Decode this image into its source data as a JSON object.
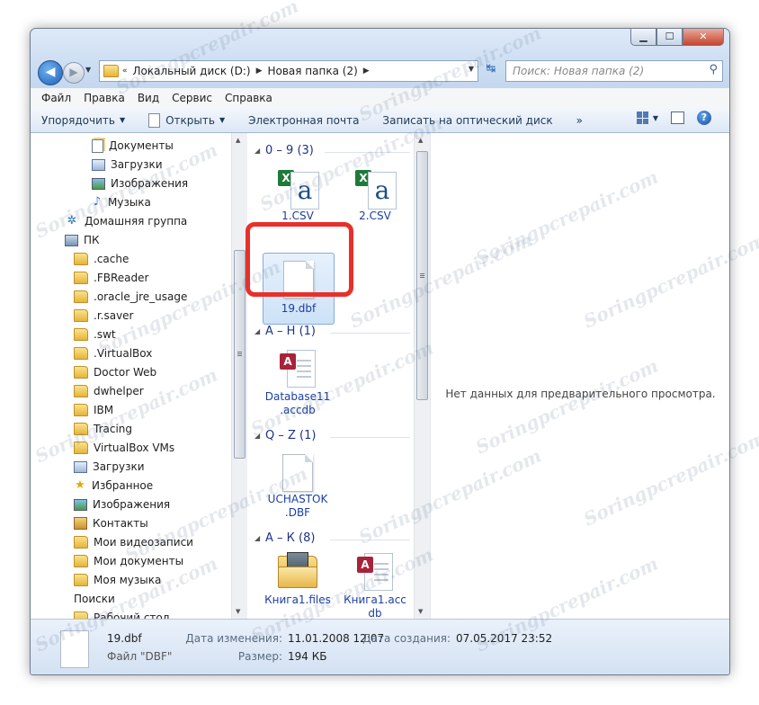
{
  "address": {
    "crumbs": [
      "Локальный диск (D:)",
      "Новая папка (2)"
    ],
    "overflow": "«"
  },
  "search": {
    "placeholder": "Поиск: Новая папка (2)"
  },
  "menu": [
    "Файл",
    "Правка",
    "Вид",
    "Сервис",
    "Справка"
  ],
  "toolbar": {
    "organize": "Упорядочить",
    "open": "Открыть",
    "email": "Электронная почта",
    "burn": "Записать на оптический диск",
    "more": "»"
  },
  "nav": [
    {
      "label": "Документы",
      "icon": "doc"
    },
    {
      "label": "Загрузки",
      "icon": "dl"
    },
    {
      "label": "Изображения",
      "icon": "img"
    },
    {
      "label": "Музыка",
      "icon": "music"
    },
    {
      "label": "Домашняя группа",
      "icon": "home"
    },
    {
      "label": "ПК",
      "icon": "pc"
    },
    {
      "label": ".cache",
      "icon": "folder"
    },
    {
      "label": ".FBReader",
      "icon": "folder"
    },
    {
      "label": ".oracle_jre_usage",
      "icon": "folder"
    },
    {
      "label": ".r.saver",
      "icon": "folder"
    },
    {
      "label": ".swt",
      "icon": "folder"
    },
    {
      "label": ".VirtualBox",
      "icon": "folder"
    },
    {
      "label": "Doctor Web",
      "icon": "folder"
    },
    {
      "label": "dwhelper",
      "icon": "folder"
    },
    {
      "label": "IBM",
      "icon": "folder"
    },
    {
      "label": "Tracing",
      "icon": "folder"
    },
    {
      "label": "VirtualBox VMs",
      "icon": "folder"
    },
    {
      "label": "Загрузки",
      "icon": "dl"
    },
    {
      "label": "Избранное",
      "icon": "star"
    },
    {
      "label": "Изображения",
      "icon": "img"
    },
    {
      "label": "Контакты",
      "icon": "contact"
    },
    {
      "label": "Мои видеозаписи",
      "icon": "folder"
    },
    {
      "label": "Мои документы",
      "icon": "folder"
    },
    {
      "label": "Моя музыка",
      "icon": "folder"
    },
    {
      "label": "Поиски",
      "icon": "search"
    },
    {
      "label": "Рабочий стол",
      "icon": "folder"
    }
  ],
  "groups": [
    {
      "title": "0 – 9 (3)"
    },
    {
      "title": "A – H (1)"
    },
    {
      "title": "Q – Z (1)"
    },
    {
      "title": "А – К (8)"
    }
  ],
  "files": [
    {
      "name": "1.CSV",
      "icon": "excel-csv"
    },
    {
      "name": "2.CSV",
      "icon": "excel-csv"
    },
    {
      "name": "19.dbf",
      "icon": "blank-doc",
      "selected": true
    },
    {
      "name_line1": "Database11",
      "name_line2": ".accdb",
      "icon": "access"
    },
    {
      "name_line1": "UCHASTOK",
      "name_line2": ".DBF",
      "icon": "blank-doc"
    },
    {
      "name": "Книга1.files",
      "icon": "folder"
    },
    {
      "name_line1": "Книга1.acc",
      "name_line2": "db",
      "icon": "access"
    }
  ],
  "preview": {
    "message": "Нет данных для предварительного просмотра."
  },
  "details": {
    "name": "19.dbf",
    "type": "Файл \"DBF\"",
    "modified_label": "Дата изменения:",
    "modified_value": "11.01.2008 12:07",
    "size_label": "Размер:",
    "size_value": "194 КБ",
    "created_label": "Дата создания:",
    "created_value": "07.05.2017 23:52"
  },
  "watermark": "Soringpcrepair.com",
  "colors": {
    "highlight": "#e8302a",
    "link": "#1a3ea3",
    "group": "#1e3287"
  }
}
